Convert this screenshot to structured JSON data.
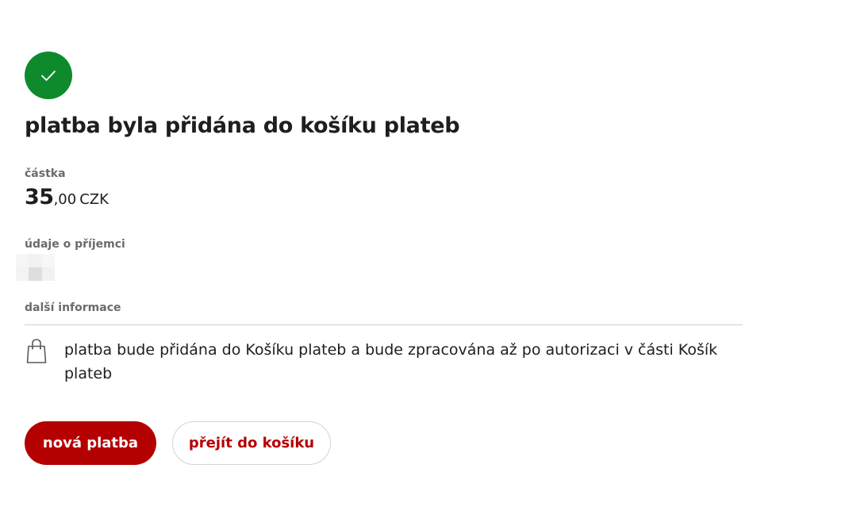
{
  "colors": {
    "success": "#0e8a2c",
    "brand_red": "#b40000",
    "label_gray": "#6b6b6b",
    "text": "#1e1e1e"
  },
  "status": {
    "icon": "checkmark-icon",
    "title": "platba byla přidána do košíku plateb"
  },
  "amount": {
    "label": "částka",
    "integer": "35",
    "decimal": ",00",
    "currency": "CZK"
  },
  "recipient": {
    "label": "údaje o příjemci"
  },
  "additional_info": {
    "label": "další informace",
    "icon": "shopping-bag-icon",
    "text": "platba bude přidána do Košíku plateb a bude zpracována až po autorizaci v části Košík plateb"
  },
  "actions": {
    "new_payment": "nová platba",
    "go_to_cart": "přejít do košíku"
  }
}
